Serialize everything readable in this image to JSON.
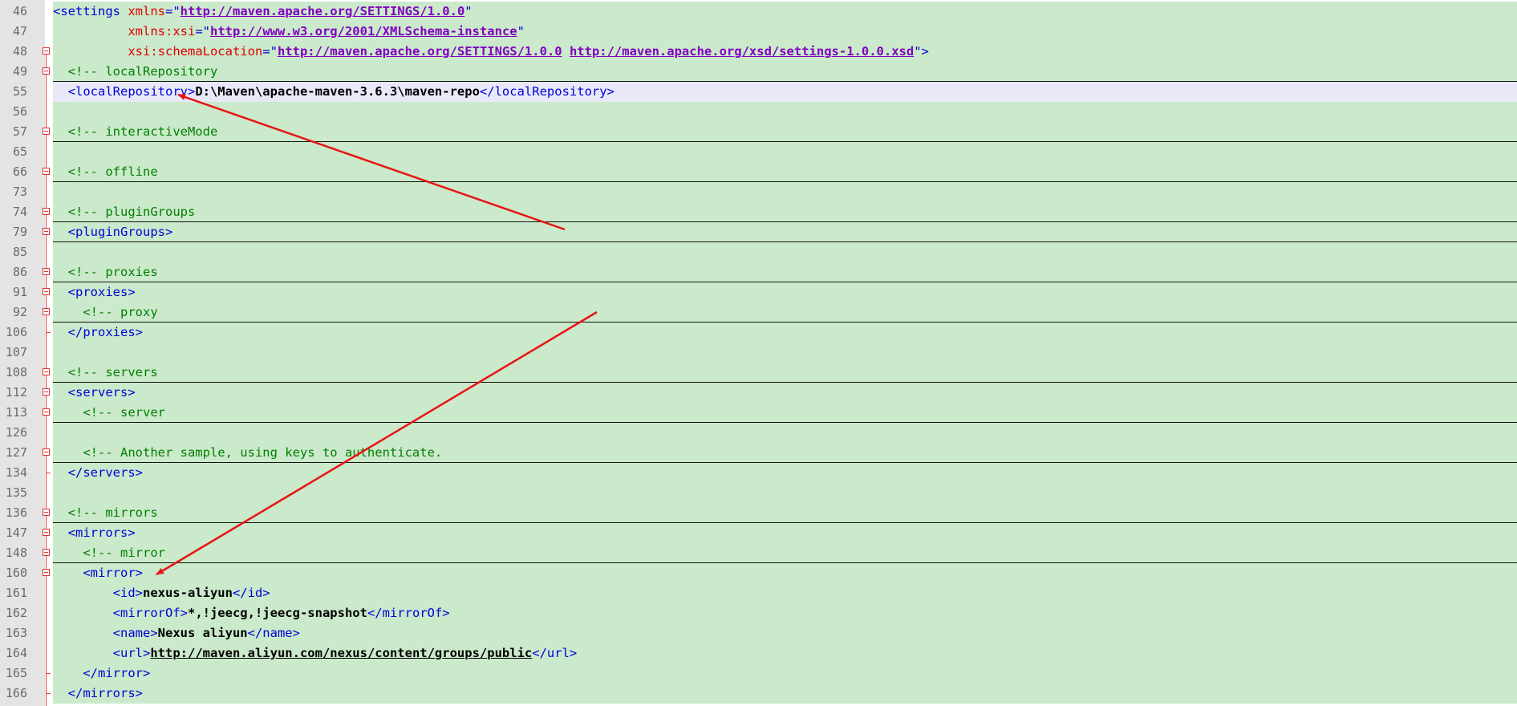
{
  "colors": {
    "background": "#cbe9cb",
    "highlight_line": "#e8e8f8",
    "tag": "#0000d8",
    "attribute": "#dd0000",
    "string": "#8000c0",
    "comment": "#008000",
    "fold_marker": "#e23c3c",
    "annotation_arrow": "#e81414"
  },
  "annotations": [
    {
      "name": "arrow-to-localRepository",
      "from_line": "79",
      "to_line": "55"
    },
    {
      "name": "arrow-to-mirror",
      "from_line": "92",
      "to_line": "160"
    }
  ],
  "lines": [
    {
      "num": "46",
      "fold": "none",
      "sep": false,
      "hl": false,
      "indent": "",
      "tokens": [
        {
          "t": "tag",
          "v": "<settings "
        },
        {
          "t": "attr",
          "v": "xmlns"
        },
        {
          "t": "tag",
          "v": "=\""
        },
        {
          "t": "url",
          "v": "http://maven.apache.org/SETTINGS/1.0.0"
        },
        {
          "t": "tag",
          "v": "\""
        }
      ]
    },
    {
      "num": "47",
      "fold": "none",
      "sep": false,
      "hl": false,
      "indent": "          ",
      "tokens": [
        {
          "t": "attr",
          "v": "xmlns:xsi"
        },
        {
          "t": "tag",
          "v": "=\""
        },
        {
          "t": "url",
          "v": "http://www.w3.org/2001/XMLSchema-instance"
        },
        {
          "t": "tag",
          "v": "\""
        }
      ]
    },
    {
      "num": "48",
      "fold": "box",
      "sep": false,
      "hl": false,
      "indent": "          ",
      "tokens": [
        {
          "t": "attr",
          "v": "xsi:schemaLocation"
        },
        {
          "t": "tag",
          "v": "=\""
        },
        {
          "t": "url",
          "v": "http://maven.apache.org/SETTINGS/1.0.0"
        },
        {
          "t": "tag",
          "v": " "
        },
        {
          "t": "url",
          "v": "http://maven.apache.org/xsd/settings-1.0.0.xsd"
        },
        {
          "t": "tag",
          "v": "\">"
        }
      ]
    },
    {
      "num": "49",
      "fold": "box",
      "sep": true,
      "hl": false,
      "indent": "  ",
      "tokens": [
        {
          "t": "com",
          "v": "<!-- localRepository"
        }
      ]
    },
    {
      "num": "55",
      "fold": "none",
      "sep": false,
      "hl": true,
      "indent": "  ",
      "tokens": [
        {
          "t": "tag",
          "v": "<localRepository>"
        },
        {
          "t": "txt",
          "v": "D:\\Maven\\apache-maven-3.6.3\\maven-repo"
        },
        {
          "t": "tag",
          "v": "</localRepository>"
        }
      ]
    },
    {
      "num": "56",
      "fold": "none",
      "sep": false,
      "hl": false,
      "indent": "",
      "tokens": []
    },
    {
      "num": "57",
      "fold": "box",
      "sep": true,
      "hl": false,
      "indent": "  ",
      "tokens": [
        {
          "t": "com",
          "v": "<!-- interactiveMode"
        }
      ]
    },
    {
      "num": "65",
      "fold": "none",
      "sep": false,
      "hl": false,
      "indent": "",
      "tokens": []
    },
    {
      "num": "66",
      "fold": "box",
      "sep": true,
      "hl": false,
      "indent": "  ",
      "tokens": [
        {
          "t": "com",
          "v": "<!-- offline"
        }
      ]
    },
    {
      "num": "73",
      "fold": "none",
      "sep": false,
      "hl": false,
      "indent": "",
      "tokens": []
    },
    {
      "num": "74",
      "fold": "box",
      "sep": true,
      "hl": false,
      "indent": "  ",
      "tokens": [
        {
          "t": "com",
          "v": "<!-- pluginGroups"
        }
      ]
    },
    {
      "num": "79",
      "fold": "box",
      "sep": true,
      "hl": false,
      "indent": "  ",
      "tokens": [
        {
          "t": "tag",
          "v": "<pluginGroups>"
        }
      ]
    },
    {
      "num": "85",
      "fold": "none",
      "sep": false,
      "hl": false,
      "indent": "",
      "tokens": []
    },
    {
      "num": "86",
      "fold": "box",
      "sep": true,
      "hl": false,
      "indent": "  ",
      "tokens": [
        {
          "t": "com",
          "v": "<!-- proxies"
        }
      ]
    },
    {
      "num": "91",
      "fold": "box",
      "sep": false,
      "hl": false,
      "indent": "  ",
      "tokens": [
        {
          "t": "tag",
          "v": "<proxies>"
        }
      ]
    },
    {
      "num": "92",
      "fold": "box",
      "sep": true,
      "hl": false,
      "indent": "    ",
      "tokens": [
        {
          "t": "com",
          "v": "<!-- proxy"
        }
      ]
    },
    {
      "num": "106",
      "fold": "end",
      "sep": false,
      "hl": false,
      "indent": "  ",
      "tokens": [
        {
          "t": "tag",
          "v": "</proxies>"
        }
      ]
    },
    {
      "num": "107",
      "fold": "none",
      "sep": false,
      "hl": false,
      "indent": "",
      "tokens": []
    },
    {
      "num": "108",
      "fold": "box",
      "sep": true,
      "hl": false,
      "indent": "  ",
      "tokens": [
        {
          "t": "com",
          "v": "<!-- servers"
        }
      ]
    },
    {
      "num": "112",
      "fold": "box",
      "sep": false,
      "hl": false,
      "indent": "  ",
      "tokens": [
        {
          "t": "tag",
          "v": "<servers>"
        }
      ]
    },
    {
      "num": "113",
      "fold": "box",
      "sep": true,
      "hl": false,
      "indent": "    ",
      "tokens": [
        {
          "t": "com",
          "v": "<!-- server"
        }
      ]
    },
    {
      "num": "126",
      "fold": "none",
      "sep": false,
      "hl": false,
      "indent": "",
      "tokens": []
    },
    {
      "num": "127",
      "fold": "box",
      "sep": true,
      "hl": false,
      "indent": "    ",
      "tokens": [
        {
          "t": "com",
          "v": "<!-- Another sample, using keys to authenticate."
        }
      ]
    },
    {
      "num": "134",
      "fold": "end",
      "sep": false,
      "hl": false,
      "indent": "  ",
      "tokens": [
        {
          "t": "tag",
          "v": "</servers>"
        }
      ]
    },
    {
      "num": "135",
      "fold": "none",
      "sep": false,
      "hl": false,
      "indent": "",
      "tokens": []
    },
    {
      "num": "136",
      "fold": "box",
      "sep": true,
      "hl": false,
      "indent": "  ",
      "tokens": [
        {
          "t": "com",
          "v": "<!-- mirrors"
        }
      ]
    },
    {
      "num": "147",
      "fold": "box",
      "sep": false,
      "hl": false,
      "indent": "  ",
      "tokens": [
        {
          "t": "tag",
          "v": "<mirrors>"
        }
      ]
    },
    {
      "num": "148",
      "fold": "box",
      "sep": true,
      "hl": false,
      "indent": "    ",
      "tokens": [
        {
          "t": "com",
          "v": "<!-- mirror"
        }
      ]
    },
    {
      "num": "160",
      "fold": "box",
      "sep": false,
      "hl": false,
      "indent": "    ",
      "tokens": [
        {
          "t": "tag",
          "v": "<mirror>"
        }
      ]
    },
    {
      "num": "161",
      "fold": "none",
      "sep": false,
      "hl": false,
      "indent": "        ",
      "tokens": [
        {
          "t": "tag",
          "v": "<id>"
        },
        {
          "t": "txt",
          "v": "nexus-aliyun"
        },
        {
          "t": "tag",
          "v": "</id>"
        }
      ]
    },
    {
      "num": "162",
      "fold": "none",
      "sep": false,
      "hl": false,
      "indent": "        ",
      "tokens": [
        {
          "t": "tag",
          "v": "<mirrorOf>"
        },
        {
          "t": "txt",
          "v": "*,!jeecg,!jeecg-snapshot"
        },
        {
          "t": "tag",
          "v": "</mirrorOf>"
        }
      ]
    },
    {
      "num": "163",
      "fold": "none",
      "sep": false,
      "hl": false,
      "indent": "        ",
      "tokens": [
        {
          "t": "tag",
          "v": "<name>"
        },
        {
          "t": "txt",
          "v": "Nexus aliyun"
        },
        {
          "t": "tag",
          "v": "</name>"
        }
      ]
    },
    {
      "num": "164",
      "fold": "none",
      "sep": false,
      "hl": false,
      "indent": "        ",
      "tokens": [
        {
          "t": "tag",
          "v": "<url>"
        },
        {
          "t": "lnk",
          "v": "http://maven.aliyun.com/nexus/content/groups/public"
        },
        {
          "t": "tag",
          "v": "</url>"
        }
      ]
    },
    {
      "num": "165",
      "fold": "end",
      "sep": false,
      "hl": false,
      "indent": "    ",
      "tokens": [
        {
          "t": "tag",
          "v": "</mirror>"
        }
      ]
    },
    {
      "num": "166",
      "fold": "end",
      "sep": false,
      "hl": false,
      "indent": "  ",
      "tokens": [
        {
          "t": "tag",
          "v": "</mirrors>"
        }
      ]
    }
  ]
}
